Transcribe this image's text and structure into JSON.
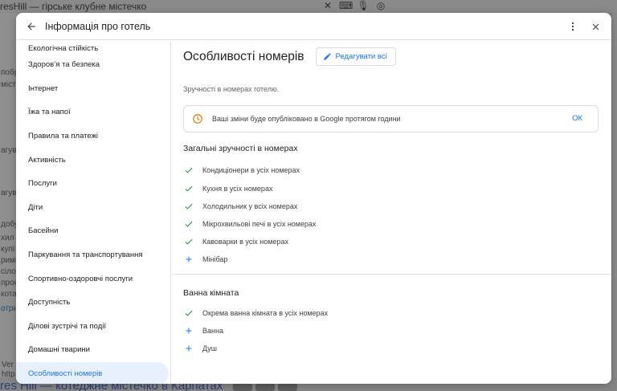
{
  "background": {
    "tab_title": "resHill — гірське клубне містечко",
    "left_fragments": [
      "побра",
      "міст",
      "агув",
      "агув",
      "добу",
      "хил",
      "купі",
      "рима",
      "сіло",
      "проє",
      "кота",
      "отри",
      "Ver",
      "http"
    ],
    "bottom_link": "res Hill — котеджне містечко в Карпатах"
  },
  "dialog": {
    "title": "Інформація про готель"
  },
  "sidebar": {
    "items": [
      {
        "label": "Екологічна стійкість"
      },
      {
        "label": "Здоров’я та безпека"
      },
      {
        "label": "Інтернет"
      },
      {
        "label": "Їжа та напої"
      },
      {
        "label": "Правила та платежі"
      },
      {
        "label": "Активність"
      },
      {
        "label": "Послуги"
      },
      {
        "label": "Діти"
      },
      {
        "label": "Басейни"
      },
      {
        "label": "Паркування та транспортування"
      },
      {
        "label": "Спортивно-оздоровчі послуги"
      },
      {
        "label": "Доступність"
      },
      {
        "label": "Ділові зустрічі та події"
      },
      {
        "label": "Домашні тварини"
      },
      {
        "label": "Особливості номерів"
      }
    ],
    "active_index": 14
  },
  "main": {
    "title": "Особливості номерів",
    "edit_button": "Редагувати всі",
    "subtitle": "Зручності в номерах готелю.",
    "notice": {
      "text": "Ваші зміни буде опубліковано в Google протягом години",
      "ok": "ОК"
    },
    "groups": [
      {
        "title": "Загальні зручності в номерах",
        "items": [
          {
            "label": "Кондиціонери в усіх номерах",
            "status": "check"
          },
          {
            "label": "Кухня в усіх номерах",
            "status": "check"
          },
          {
            "label": "Холодильник у всіх номерах",
            "status": "check"
          },
          {
            "label": "Мікрохвильові печі в усіх номерах",
            "status": "check"
          },
          {
            "label": "Кавоварки в усіх номерах",
            "status": "check"
          },
          {
            "label": "Мінібар",
            "status": "add"
          }
        ]
      },
      {
        "title": "Ванна кімната",
        "items": [
          {
            "label": "Окрема ванна кімната в усіх номерах",
            "status": "check"
          },
          {
            "label": "Ванна",
            "status": "add"
          },
          {
            "label": "Душ",
            "status": "add"
          }
        ]
      }
    ]
  },
  "colors": {
    "accent": "#1a73e8",
    "check": "#1e8e3e",
    "notice_icon": "#e37400",
    "active_bg": "#e8f0fe"
  }
}
